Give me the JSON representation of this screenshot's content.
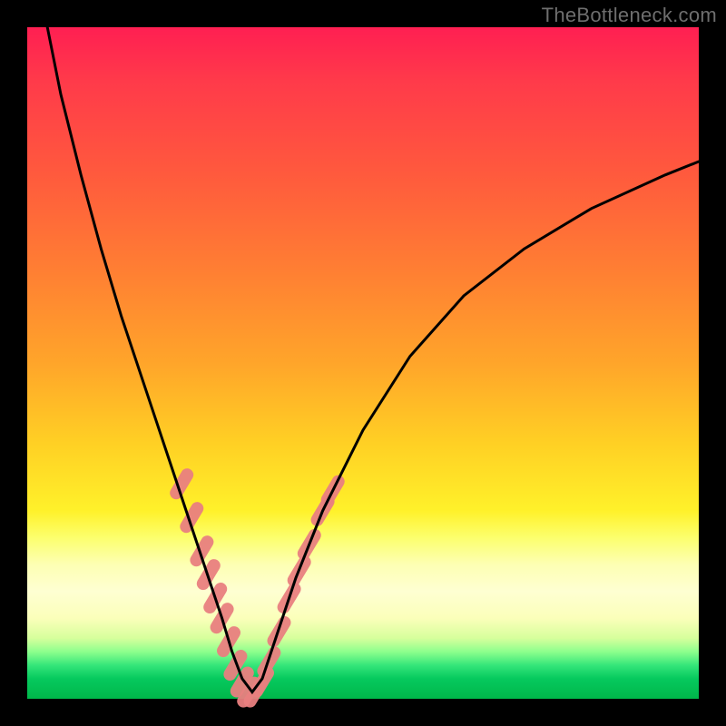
{
  "watermark": "TheBottleneck.com",
  "chart_data": {
    "type": "line",
    "title": "",
    "xlabel": "",
    "ylabel": "",
    "xlim": [
      0,
      100
    ],
    "ylim": [
      0,
      100
    ],
    "grid": false,
    "legend": false,
    "series": [
      {
        "name": "bottleneck-curve",
        "color": "#000000",
        "x": [
          3,
          5,
          8,
          11,
          14,
          17,
          19,
          21,
          23,
          25,
          27,
          29,
          30.5,
          32,
          33.5,
          35,
          37,
          40,
          44,
          50,
          57,
          65,
          74,
          84,
          95,
          100
        ],
        "y": [
          100,
          90,
          78,
          67,
          57,
          48,
          42,
          36,
          30,
          24,
          18,
          12,
          7,
          3,
          1,
          3,
          9,
          18,
          28,
          40,
          51,
          60,
          67,
          73,
          78,
          80
        ]
      }
    ],
    "markers": [
      {
        "name": "confidence-dots",
        "color": "#e98080",
        "shape": "pill",
        "points": [
          {
            "x": 23.0,
            "y": 32.0
          },
          {
            "x": 24.5,
            "y": 27.0
          },
          {
            "x": 26.0,
            "y": 22.0
          },
          {
            "x": 27.0,
            "y": 18.5
          },
          {
            "x": 28.0,
            "y": 15.0
          },
          {
            "x": 29.0,
            "y": 12.0
          },
          {
            "x": 30.0,
            "y": 8.5
          },
          {
            "x": 31.0,
            "y": 5.0
          },
          {
            "x": 32.0,
            "y": 2.5
          },
          {
            "x": 33.0,
            "y": 1.0
          },
          {
            "x": 34.0,
            "y": 1.0
          },
          {
            "x": 35.0,
            "y": 2.5
          },
          {
            "x": 36.0,
            "y": 5.5
          },
          {
            "x": 37.5,
            "y": 10.0
          },
          {
            "x": 39.0,
            "y": 15.0
          },
          {
            "x": 40.5,
            "y": 19.0
          },
          {
            "x": 42.0,
            "y": 23.0
          },
          {
            "x": 44.0,
            "y": 28.0
          },
          {
            "x": 45.5,
            "y": 31.0
          }
        ]
      }
    ]
  }
}
